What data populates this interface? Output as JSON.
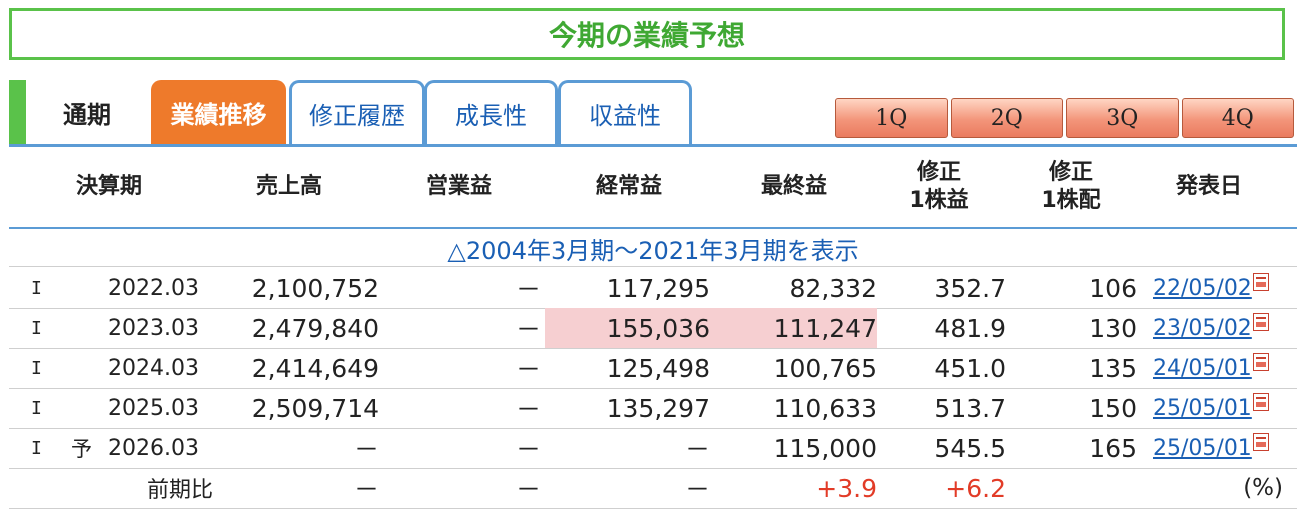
{
  "title": "今期の業績予想",
  "tabs": {
    "static": "通期",
    "active": "業績推移",
    "others": [
      "修正履歴",
      "成長性",
      "収益性"
    ]
  },
  "quarters": [
    "1Q",
    "2Q",
    "3Q",
    "4Q"
  ],
  "headers": {
    "period": "決算期",
    "sales": "売上高",
    "operating": "営業益",
    "ordinary": "経常益",
    "net": "最終益",
    "eps_line1": "修正",
    "eps_line2": "1株益",
    "div_line1": "修正",
    "div_line2": "1株配",
    "announce": "発表日"
  },
  "expand_link": "△2004年3月期～2021年3月期を表示",
  "rows": [
    {
      "type": "I",
      "forecast": "",
      "period": "2022.03",
      "sales": "2,100,752",
      "operating": "－",
      "ordinary": "117,295",
      "net": "82,332",
      "eps": "352.7",
      "div": "106",
      "date": "22/05/02"
    },
    {
      "type": "I",
      "forecast": "",
      "period": "2023.03",
      "sales": "2,479,840",
      "operating": "－",
      "ordinary": "155,036",
      "net": "111,247",
      "eps": "481.9",
      "div": "130",
      "date": "23/05/02"
    },
    {
      "type": "I",
      "forecast": "",
      "period": "2024.03",
      "sales": "2,414,649",
      "operating": "－",
      "ordinary": "125,498",
      "net": "100,765",
      "eps": "451.0",
      "div": "135",
      "date": "24/05/01"
    },
    {
      "type": "I",
      "forecast": "",
      "period": "2025.03",
      "sales": "2,509,714",
      "operating": "－",
      "ordinary": "135,297",
      "net": "110,633",
      "eps": "513.7",
      "div": "150",
      "date": "25/05/01"
    },
    {
      "type": "I",
      "forecast": "予",
      "period": "2026.03",
      "sales": "－",
      "operating": "－",
      "ordinary": "－",
      "net": "115,000",
      "eps": "545.5",
      "div": "165",
      "date": "25/05/01"
    }
  ],
  "yoy": {
    "label": "前期比",
    "sales": "－",
    "operating": "－",
    "ordinary": "－",
    "net": "+3.9",
    "eps": "+6.2",
    "unit": "(%)"
  },
  "colors": {
    "green": "#5ac24a",
    "orange_tab": "#ee7a2b",
    "blue_border": "#5b9bd5",
    "link_blue": "#1a5fb4",
    "highlight_pink": "#f6cfd1",
    "positive_red": "#e23b27"
  },
  "icons": {
    "announcement_doc": "pdf-icon"
  }
}
